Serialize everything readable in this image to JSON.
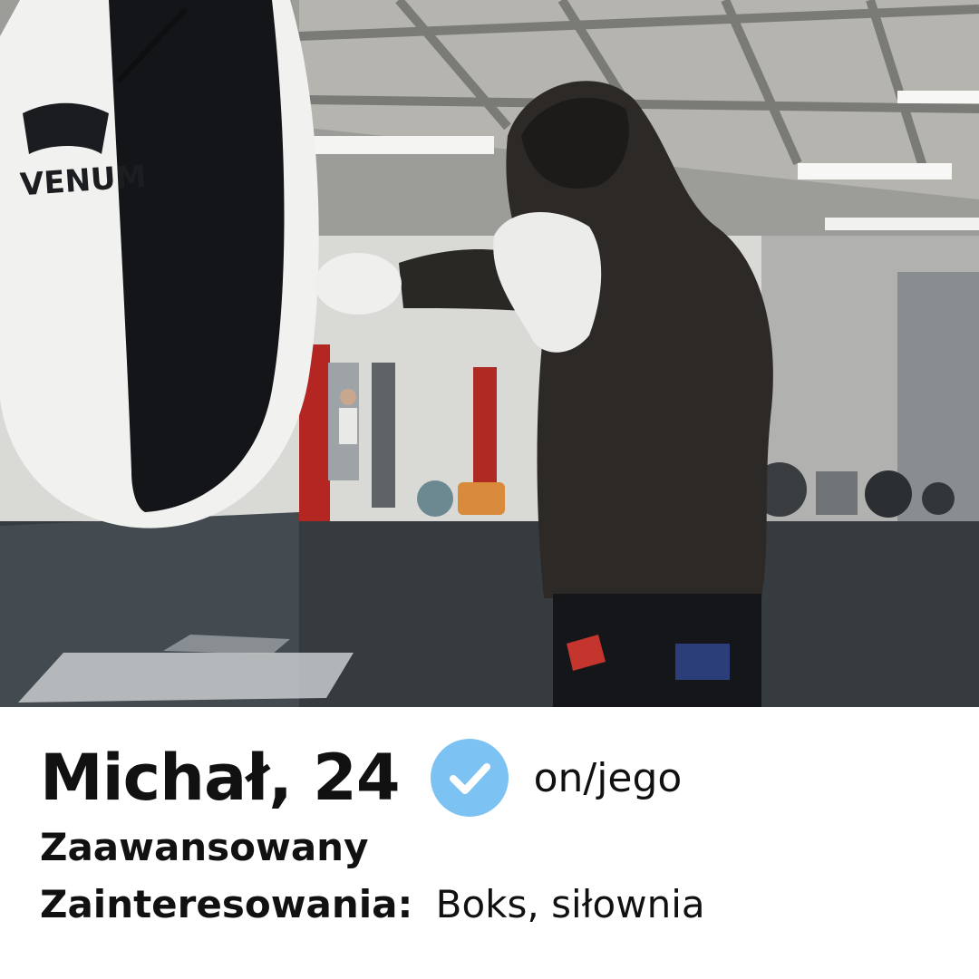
{
  "photo": {
    "brand_text": "VENUM",
    "alt": "Osoba w kapturze trenująca na worku bokserskim na siłowni"
  },
  "profile": {
    "name_age": "Michał, 24",
    "verified_icon": "verified-check-icon",
    "verified_color": "#7cc2f2",
    "pronouns": "on/jego",
    "level": "Zaawansowany",
    "interests_label": "Zainteresowania:",
    "interests_value": "Boks, siłownia"
  }
}
